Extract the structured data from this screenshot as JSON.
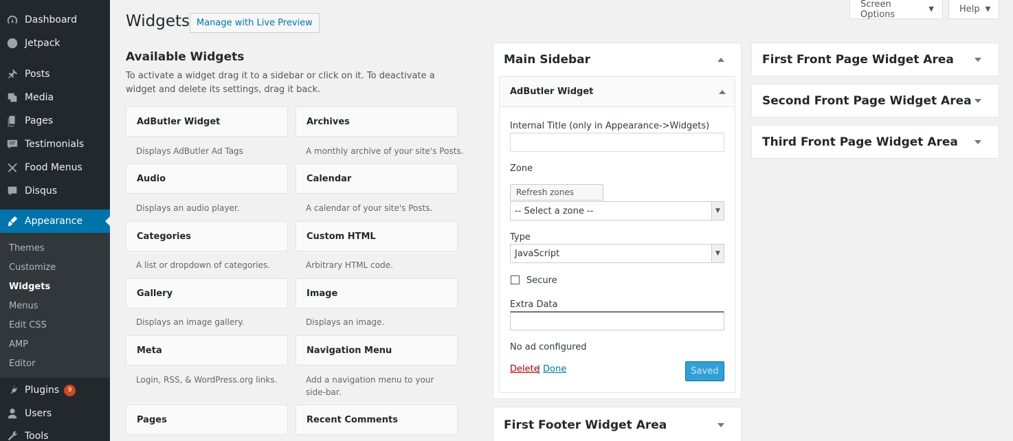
{
  "admin_menu": {
    "items": [
      {
        "label": "Dashboard",
        "icon": "dashboard-icon"
      },
      {
        "label": "Jetpack",
        "icon": "jetpack-icon"
      },
      {
        "label": "Posts",
        "icon": "pin-icon"
      },
      {
        "label": "Media",
        "icon": "media-icon"
      },
      {
        "label": "Pages",
        "icon": "pages-icon"
      },
      {
        "label": "Testimonials",
        "icon": "testimonial-icon"
      },
      {
        "label": "Food Menus",
        "icon": "food-icon"
      },
      {
        "label": "Disqus",
        "icon": "comment-icon"
      },
      {
        "label": "Appearance",
        "icon": "brush-icon"
      },
      {
        "label": "Plugins",
        "icon": "plugin-icon",
        "badge": "9"
      },
      {
        "label": "Users",
        "icon": "users-icon"
      },
      {
        "label": "Tools",
        "icon": "tools-icon"
      }
    ],
    "submenu": [
      "Themes",
      "Customize",
      "Widgets",
      "Menus",
      "Edit CSS",
      "AMP",
      "Editor"
    ],
    "accent": "#0073aa",
    "bg": "#23282d"
  },
  "header": {
    "title": "Widgets",
    "live_preview": "Manage with Live Preview",
    "screen_options": "Screen Options",
    "help": "Help"
  },
  "available": {
    "title": "Available Widgets",
    "description": "To activate a widget drag it to a sidebar or click on it. To deactivate a widget and delete its settings, drag it back.",
    "widgets": [
      {
        "name": "AdButler Widget",
        "desc": "Displays AdButler Ad Tags"
      },
      {
        "name": "Archives",
        "desc": "A monthly archive of your site's Posts."
      },
      {
        "name": "Audio",
        "desc": "Displays an audio player."
      },
      {
        "name": "Calendar",
        "desc": "A calendar of your site's Posts."
      },
      {
        "name": "Categories",
        "desc": "A list or dropdown of categories."
      },
      {
        "name": "Custom HTML",
        "desc": "Arbitrary HTML code."
      },
      {
        "name": "Gallery",
        "desc": "Displays an image gallery."
      },
      {
        "name": "Image",
        "desc": "Displays an image."
      },
      {
        "name": "Meta",
        "desc": "Login, RSS, & WordPress.org links."
      },
      {
        "name": "Navigation Menu",
        "desc": "Add a navigation menu to your side-bar."
      },
      {
        "name": "Pages",
        "desc": ""
      },
      {
        "name": "Recent Comments",
        "desc": ""
      }
    ]
  },
  "main_sidebar": {
    "title": "Main Sidebar",
    "widget": {
      "title": "AdButler Widget",
      "internal_title_label": "Internal Title (only in Appearance->Widgets)",
      "internal_title_value": "",
      "zone_label": "Zone",
      "refresh_zones": "Refresh zones",
      "zone_selected": "-- Select a zone --",
      "type_label": "Type",
      "type_selected": "JavaScript",
      "secure_label": "Secure",
      "extra_data_label": "Extra Data",
      "extra_data_value": "",
      "status": "No ad configured",
      "delete": "Delete",
      "separator": "|",
      "done": "Done",
      "saved": "Saved"
    }
  },
  "footer_area": {
    "title": "First Footer Widget Area"
  },
  "front_areas": [
    {
      "title": "First Front Page Widget Area"
    },
    {
      "title": "Second Front Page Widget Area"
    },
    {
      "title": "Third Front Page Widget Area"
    }
  ]
}
